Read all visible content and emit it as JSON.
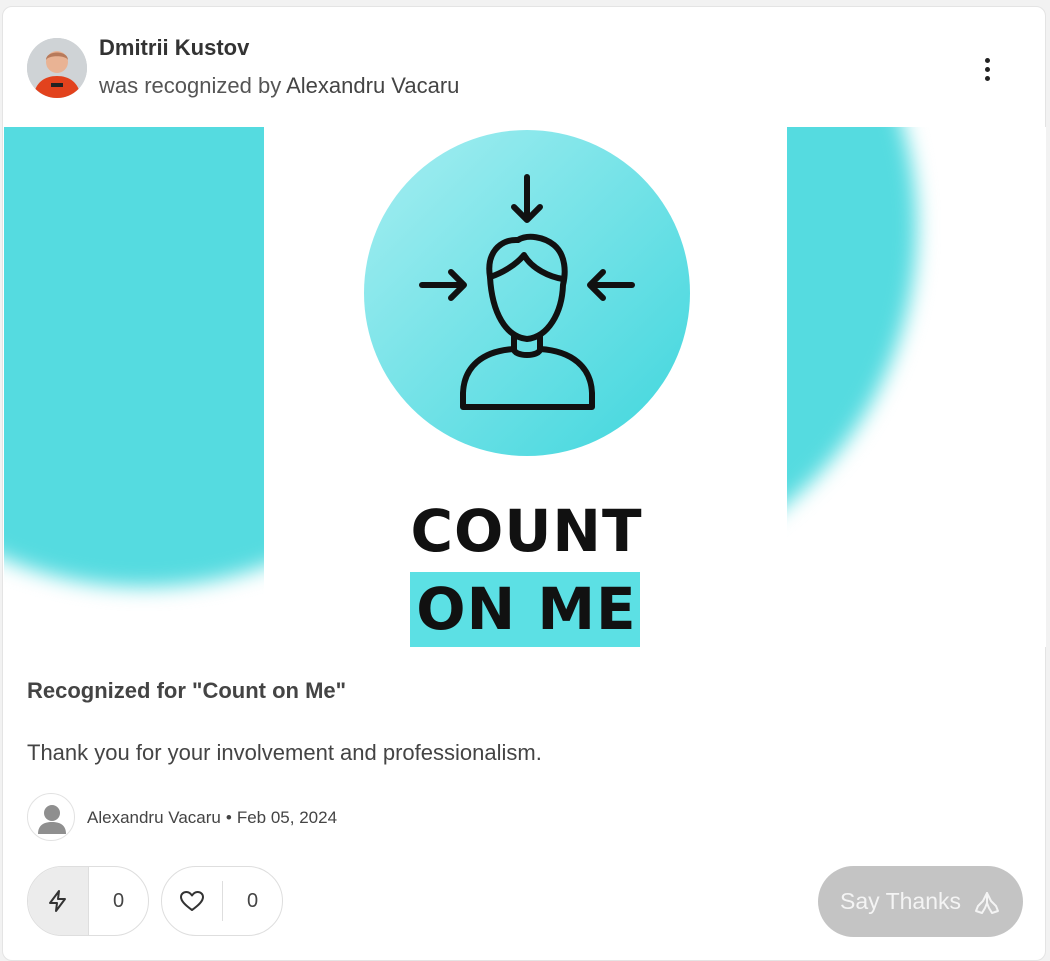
{
  "post": {
    "recipient_name": "Dmitrii Kustov",
    "recognized_by_prefix": "was recognized by",
    "recognizer_name": "Alexandru Vacaru"
  },
  "badge": {
    "line1": "COUNT",
    "line2": "ON ME",
    "accent_color": "#5ce0e4"
  },
  "content": {
    "recognized_for": "Recognized for \"Count on Me\"",
    "message": "Thank you for your involvement and professionalism."
  },
  "author": {
    "name": "Alexandru Vacaru",
    "separator": "•",
    "date": "Feb 05, 2024"
  },
  "reactions": {
    "zap_count": "0",
    "heart_count": "0"
  },
  "actions": {
    "say_thanks_label": "Say Thanks",
    "say_thanks_color": "#c4c4c4"
  },
  "icons": {
    "menu": "more-vertical-icon",
    "zap": "zap-icon",
    "heart": "heart-icon",
    "thanks": "praying-hands-icon",
    "badge": "person-focus-icon"
  }
}
